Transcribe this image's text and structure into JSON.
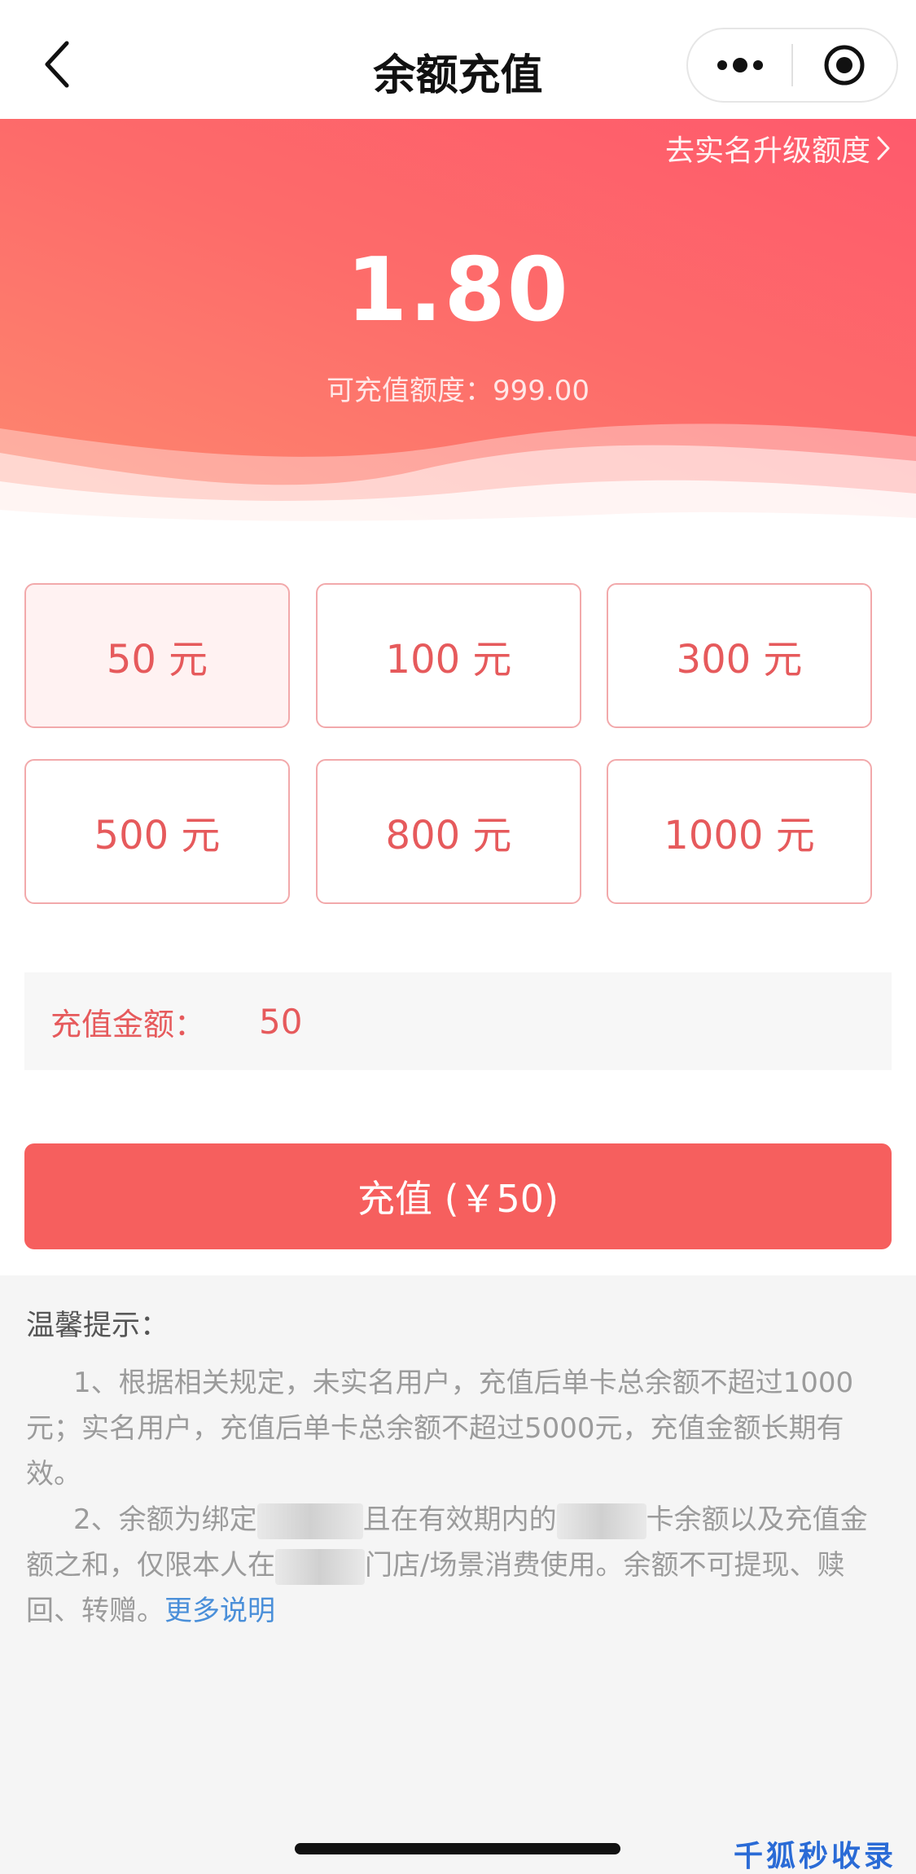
{
  "nav": {
    "title": "余额充值",
    "back_icon": "chevron-left-icon",
    "more_icon": "more-dots-icon",
    "close_icon": "target-circle-icon"
  },
  "banner": {
    "upgrade_label": "去实名升级额度",
    "balance": "1.80",
    "limit_text": "可充值额度：999.00",
    "gradient_colors": [
      "#fe5a6c",
      "#fd8a6f"
    ]
  },
  "amounts": [
    {
      "label": "50 元",
      "selected": true
    },
    {
      "label": "100 元",
      "selected": false
    },
    {
      "label": "300 元",
      "selected": false
    },
    {
      "label": "500 元",
      "selected": false
    },
    {
      "label": "800 元",
      "selected": false
    },
    {
      "label": "1000 元",
      "selected": false
    }
  ],
  "input": {
    "label": "充值金额：",
    "value": "50"
  },
  "recharge_button": {
    "label": "充值 (￥50)"
  },
  "tips": {
    "title": "温馨提示：",
    "para1": "1、根据相关规定，未实名用户，充值后单卡总余额不超过1000元；实名用户，充值后单卡总余额不超过5000元，充值金额长期有效。",
    "para2_a": "2、余额为绑定",
    "para2_b": "且在有效期内的",
    "para2_c": "卡余额以及充值金额之和，仅限本人在",
    "para2_d": "门店/场景消费使用。余额不可提现、赎回、转赠。",
    "more_link": "更多说明"
  },
  "watermark": "千狐秒收录",
  "colors": {
    "accent": "#e65a5c",
    "button": "#f65f5e",
    "link": "#4a8fd9"
  }
}
